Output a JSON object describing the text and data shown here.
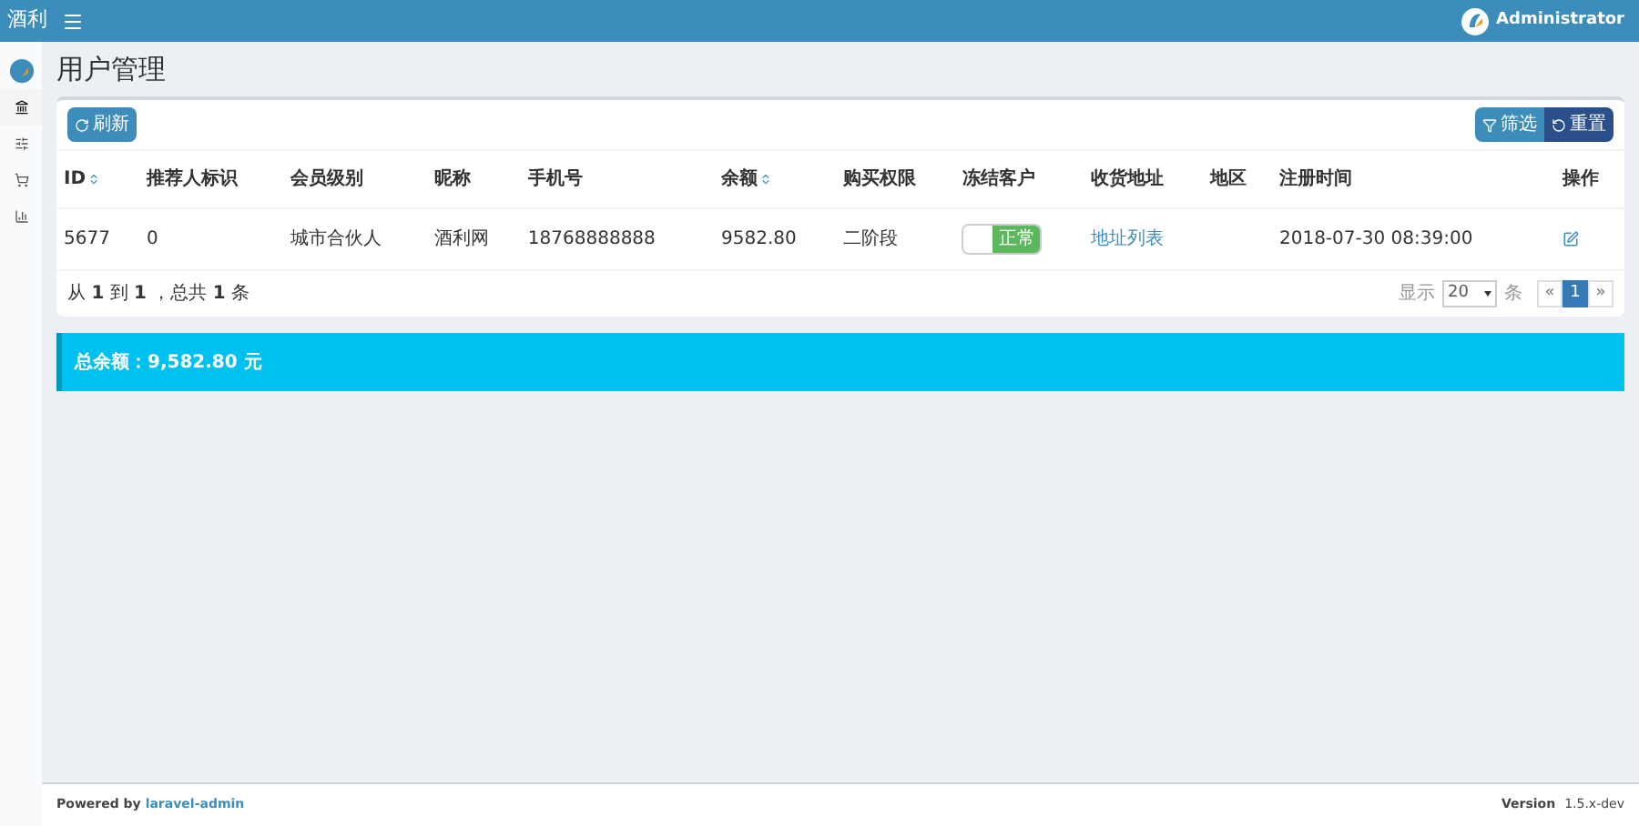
{
  "header": {
    "brand": "酒利",
    "user": "Administrator"
  },
  "sidebar": {
    "items": [
      {
        "kind": "bank",
        "selected": true
      },
      {
        "kind": "sliders",
        "selected": false
      },
      {
        "kind": "cart",
        "selected": false
      },
      {
        "kind": "chart",
        "selected": false
      }
    ]
  },
  "page_title": "用户管理",
  "toolbar": {
    "refresh": "刷新",
    "filter": "筛选",
    "reset": "重置"
  },
  "table": {
    "columns": [
      {
        "label": "ID",
        "sortable": true
      },
      {
        "label": "推荐人标识",
        "sortable": false
      },
      {
        "label": "会员级别",
        "sortable": false
      },
      {
        "label": "昵称",
        "sortable": false
      },
      {
        "label": "手机号",
        "sortable": false
      },
      {
        "label": "余额",
        "sortable": true
      },
      {
        "label": "购买权限",
        "sortable": false
      },
      {
        "label": "冻结客户",
        "sortable": false
      },
      {
        "label": "收货地址",
        "sortable": false
      },
      {
        "label": "地区",
        "sortable": false
      },
      {
        "label": "注册时间",
        "sortable": false
      },
      {
        "label": "操作",
        "sortable": false
      }
    ],
    "rows": [
      {
        "id": "5677",
        "referrer": "0",
        "level": "城市合伙人",
        "nickname": "酒利网",
        "phone": "18768888888",
        "balance": "9582.80",
        "permission": "二阶段",
        "frozen": {
          "on": false,
          "label": "正常"
        },
        "address_link": "地址列表",
        "registered": "2018-07-30 08:39:00"
      }
    ]
  },
  "summary": "从 **1** 到 **1** ，总共 **1** 条",
  "pagination": {
    "show_label": "显示",
    "per_page": "20",
    "unit": "条",
    "prev": "«",
    "pages": [
      {
        "label": "1",
        "selected": true
      }
    ],
    "next": "»"
  },
  "total": {
    "label": "总余额：",
    "value": "9,582.80 元"
  },
  "footer": {
    "powered": "Powered by",
    "link": "laravel-admin",
    "version_label": "Version",
    "version": "1.5.x-dev"
  }
}
